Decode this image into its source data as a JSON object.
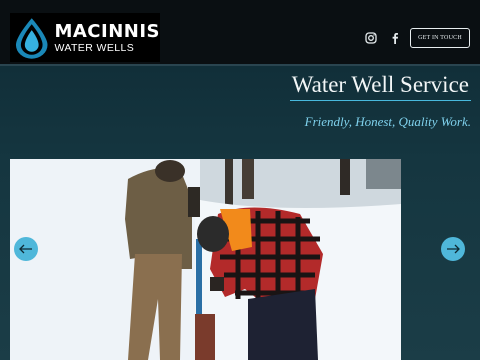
{
  "header": {
    "logo": {
      "name": "MACINNIS",
      "subtitle": "WATER WELLS"
    },
    "social": [
      {
        "icon": "instagram-icon"
      },
      {
        "icon": "facebook-icon"
      }
    ],
    "cta_label": "GET IN TOUCH"
  },
  "hero": {
    "title": "Water Well Service",
    "tagline": "Friendly, Honest, Quality Work."
  },
  "slideshow": {
    "prev_icon": "arrow-left-icon",
    "next_icon": "arrow-right-icon"
  },
  "colors": {
    "accent": "#4fb7da",
    "tagline": "#7fd1ec",
    "header_bg": "#0a0f12",
    "page_bg": "#153640"
  }
}
